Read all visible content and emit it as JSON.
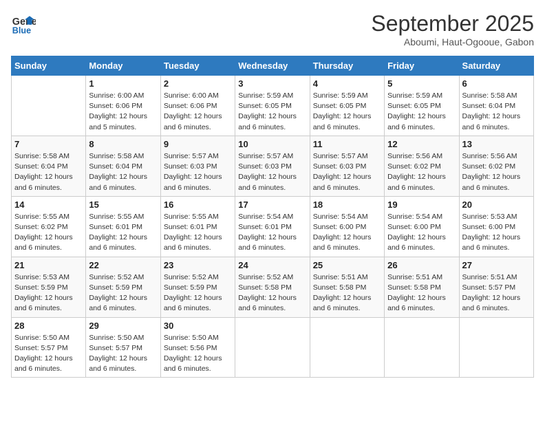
{
  "header": {
    "logo_general": "General",
    "logo_blue": "Blue",
    "month": "September 2025",
    "location": "Aboumi, Haut-Ogooue, Gabon"
  },
  "days_of_week": [
    "Sunday",
    "Monday",
    "Tuesday",
    "Wednesday",
    "Thursday",
    "Friday",
    "Saturday"
  ],
  "weeks": [
    [
      {
        "day": "",
        "info": ""
      },
      {
        "day": "1",
        "info": "Sunrise: 6:00 AM\nSunset: 6:06 PM\nDaylight: 12 hours\nand 5 minutes."
      },
      {
        "day": "2",
        "info": "Sunrise: 6:00 AM\nSunset: 6:06 PM\nDaylight: 12 hours\nand 6 minutes."
      },
      {
        "day": "3",
        "info": "Sunrise: 5:59 AM\nSunset: 6:05 PM\nDaylight: 12 hours\nand 6 minutes."
      },
      {
        "day": "4",
        "info": "Sunrise: 5:59 AM\nSunset: 6:05 PM\nDaylight: 12 hours\nand 6 minutes."
      },
      {
        "day": "5",
        "info": "Sunrise: 5:59 AM\nSunset: 6:05 PM\nDaylight: 12 hours\nand 6 minutes."
      },
      {
        "day": "6",
        "info": "Sunrise: 5:58 AM\nSunset: 6:04 PM\nDaylight: 12 hours\nand 6 minutes."
      }
    ],
    [
      {
        "day": "7",
        "info": "Sunrise: 5:58 AM\nSunset: 6:04 PM\nDaylight: 12 hours\nand 6 minutes."
      },
      {
        "day": "8",
        "info": "Sunrise: 5:58 AM\nSunset: 6:04 PM\nDaylight: 12 hours\nand 6 minutes."
      },
      {
        "day": "9",
        "info": "Sunrise: 5:57 AM\nSunset: 6:03 PM\nDaylight: 12 hours\nand 6 minutes."
      },
      {
        "day": "10",
        "info": "Sunrise: 5:57 AM\nSunset: 6:03 PM\nDaylight: 12 hours\nand 6 minutes."
      },
      {
        "day": "11",
        "info": "Sunrise: 5:57 AM\nSunset: 6:03 PM\nDaylight: 12 hours\nand 6 minutes."
      },
      {
        "day": "12",
        "info": "Sunrise: 5:56 AM\nSunset: 6:02 PM\nDaylight: 12 hours\nand 6 minutes."
      },
      {
        "day": "13",
        "info": "Sunrise: 5:56 AM\nSunset: 6:02 PM\nDaylight: 12 hours\nand 6 minutes."
      }
    ],
    [
      {
        "day": "14",
        "info": "Sunrise: 5:55 AM\nSunset: 6:02 PM\nDaylight: 12 hours\nand 6 minutes."
      },
      {
        "day": "15",
        "info": "Sunrise: 5:55 AM\nSunset: 6:01 PM\nDaylight: 12 hours\nand 6 minutes."
      },
      {
        "day": "16",
        "info": "Sunrise: 5:55 AM\nSunset: 6:01 PM\nDaylight: 12 hours\nand 6 minutes."
      },
      {
        "day": "17",
        "info": "Sunrise: 5:54 AM\nSunset: 6:01 PM\nDaylight: 12 hours\nand 6 minutes."
      },
      {
        "day": "18",
        "info": "Sunrise: 5:54 AM\nSunset: 6:00 PM\nDaylight: 12 hours\nand 6 minutes."
      },
      {
        "day": "19",
        "info": "Sunrise: 5:54 AM\nSunset: 6:00 PM\nDaylight: 12 hours\nand 6 minutes."
      },
      {
        "day": "20",
        "info": "Sunrise: 5:53 AM\nSunset: 6:00 PM\nDaylight: 12 hours\nand 6 minutes."
      }
    ],
    [
      {
        "day": "21",
        "info": "Sunrise: 5:53 AM\nSunset: 5:59 PM\nDaylight: 12 hours\nand 6 minutes."
      },
      {
        "day": "22",
        "info": "Sunrise: 5:52 AM\nSunset: 5:59 PM\nDaylight: 12 hours\nand 6 minutes."
      },
      {
        "day": "23",
        "info": "Sunrise: 5:52 AM\nSunset: 5:59 PM\nDaylight: 12 hours\nand 6 minutes."
      },
      {
        "day": "24",
        "info": "Sunrise: 5:52 AM\nSunset: 5:58 PM\nDaylight: 12 hours\nand 6 minutes."
      },
      {
        "day": "25",
        "info": "Sunrise: 5:51 AM\nSunset: 5:58 PM\nDaylight: 12 hours\nand 6 minutes."
      },
      {
        "day": "26",
        "info": "Sunrise: 5:51 AM\nSunset: 5:58 PM\nDaylight: 12 hours\nand 6 minutes."
      },
      {
        "day": "27",
        "info": "Sunrise: 5:51 AM\nSunset: 5:57 PM\nDaylight: 12 hours\nand 6 minutes."
      }
    ],
    [
      {
        "day": "28",
        "info": "Sunrise: 5:50 AM\nSunset: 5:57 PM\nDaylight: 12 hours\nand 6 minutes."
      },
      {
        "day": "29",
        "info": "Sunrise: 5:50 AM\nSunset: 5:57 PM\nDaylight: 12 hours\nand 6 minutes."
      },
      {
        "day": "30",
        "info": "Sunrise: 5:50 AM\nSunset: 5:56 PM\nDaylight: 12 hours\nand 6 minutes."
      },
      {
        "day": "",
        "info": ""
      },
      {
        "day": "",
        "info": ""
      },
      {
        "day": "",
        "info": ""
      },
      {
        "day": "",
        "info": ""
      }
    ]
  ]
}
